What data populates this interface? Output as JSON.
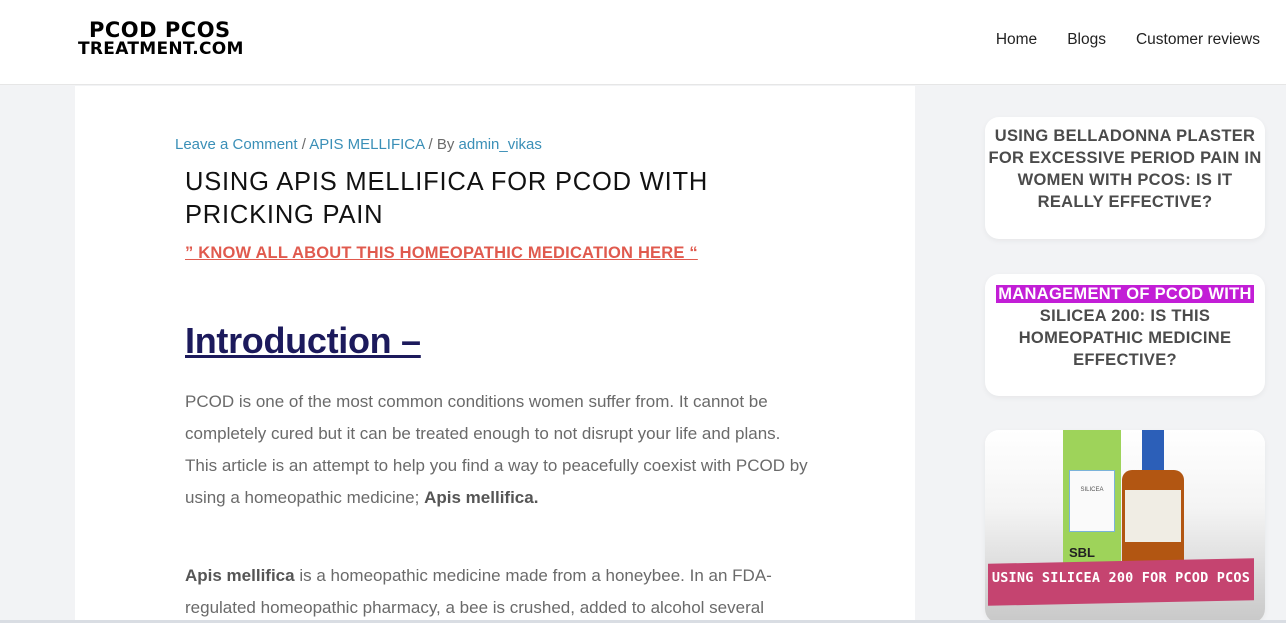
{
  "header": {
    "logo_line1": "PCOD PCOS",
    "logo_line2": "TREATMENT.COM",
    "nav": [
      "Home",
      "Blogs",
      "Customer reviews"
    ]
  },
  "post": {
    "meta_comment": "Leave a Comment",
    "meta_category": "APIS MELLIFICA",
    "meta_by": "By",
    "meta_author": "admin_vikas",
    "meta_sep": "/",
    "title": "USING APIS MELLIFICA FOR PCOD WITH PRICKING PAIN",
    "subtitle": "”  KNOW ALL ABOUT THIS HOMEOPATHIC MEDICATION HERE “",
    "intro_heading": "Introduction –",
    "p1_text": "PCOD is one of the most common conditions women suffer from. It cannot be completely cured but it can be treated enough to not disrupt your life and plans. This article is an attempt to help you find a way to peacefully coexist with PCOD by using a homeopathic medicine;",
    "p1_bold": "Apis mellifica.",
    "p2_bold": "Apis mellifica",
    "p2_text": "is a homeopathic medicine made from a honeybee. In an FDA-regulated homeopathic pharmacy, a bee is crushed, added to alcohol several"
  },
  "sidebar": {
    "card1_title": "USING BELLADONNA PLASTER FOR EXCESSIVE PERIOD PAIN IN WOMEN WITH PCOS: IS IT REALLY EFFECTIVE?",
    "card2_highlight": "MANAGEMENT OF PCOD WITH",
    "card2_rest": "SILICEA 200: IS THIS HOMEOPATHIC MEDICINE EFFECTIVE?",
    "card3_box_label": "SILICEA",
    "card3_box_brand": "SBL",
    "card3_banner": "USING SILICEA 200 FOR PCOD PCOS"
  },
  "colors": {
    "link": "#3a8fb7",
    "subtitle": "#e05a4e",
    "heading": "#1c1a5c",
    "highlight": "#c21ed6"
  }
}
